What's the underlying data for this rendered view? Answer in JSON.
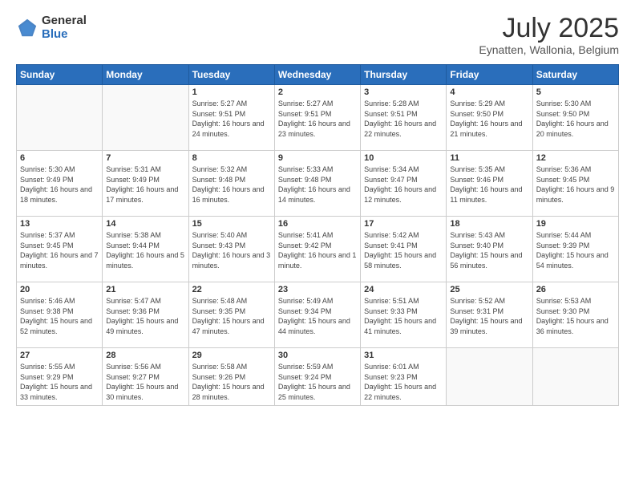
{
  "logo": {
    "general": "General",
    "blue": "Blue"
  },
  "header": {
    "month": "July 2025",
    "location": "Eynatten, Wallonia, Belgium"
  },
  "days_header": [
    "Sunday",
    "Monday",
    "Tuesday",
    "Wednesday",
    "Thursday",
    "Friday",
    "Saturday"
  ],
  "weeks": [
    [
      {
        "num": "",
        "info": ""
      },
      {
        "num": "",
        "info": ""
      },
      {
        "num": "1",
        "info": "Sunrise: 5:27 AM\nSunset: 9:51 PM\nDaylight: 16 hours and 24 minutes."
      },
      {
        "num": "2",
        "info": "Sunrise: 5:27 AM\nSunset: 9:51 PM\nDaylight: 16 hours and 23 minutes."
      },
      {
        "num": "3",
        "info": "Sunrise: 5:28 AM\nSunset: 9:51 PM\nDaylight: 16 hours and 22 minutes."
      },
      {
        "num": "4",
        "info": "Sunrise: 5:29 AM\nSunset: 9:50 PM\nDaylight: 16 hours and 21 minutes."
      },
      {
        "num": "5",
        "info": "Sunrise: 5:30 AM\nSunset: 9:50 PM\nDaylight: 16 hours and 20 minutes."
      }
    ],
    [
      {
        "num": "6",
        "info": "Sunrise: 5:30 AM\nSunset: 9:49 PM\nDaylight: 16 hours and 18 minutes."
      },
      {
        "num": "7",
        "info": "Sunrise: 5:31 AM\nSunset: 9:49 PM\nDaylight: 16 hours and 17 minutes."
      },
      {
        "num": "8",
        "info": "Sunrise: 5:32 AM\nSunset: 9:48 PM\nDaylight: 16 hours and 16 minutes."
      },
      {
        "num": "9",
        "info": "Sunrise: 5:33 AM\nSunset: 9:48 PM\nDaylight: 16 hours and 14 minutes."
      },
      {
        "num": "10",
        "info": "Sunrise: 5:34 AM\nSunset: 9:47 PM\nDaylight: 16 hours and 12 minutes."
      },
      {
        "num": "11",
        "info": "Sunrise: 5:35 AM\nSunset: 9:46 PM\nDaylight: 16 hours and 11 minutes."
      },
      {
        "num": "12",
        "info": "Sunrise: 5:36 AM\nSunset: 9:45 PM\nDaylight: 16 hours and 9 minutes."
      }
    ],
    [
      {
        "num": "13",
        "info": "Sunrise: 5:37 AM\nSunset: 9:45 PM\nDaylight: 16 hours and 7 minutes."
      },
      {
        "num": "14",
        "info": "Sunrise: 5:38 AM\nSunset: 9:44 PM\nDaylight: 16 hours and 5 minutes."
      },
      {
        "num": "15",
        "info": "Sunrise: 5:40 AM\nSunset: 9:43 PM\nDaylight: 16 hours and 3 minutes."
      },
      {
        "num": "16",
        "info": "Sunrise: 5:41 AM\nSunset: 9:42 PM\nDaylight: 16 hours and 1 minute."
      },
      {
        "num": "17",
        "info": "Sunrise: 5:42 AM\nSunset: 9:41 PM\nDaylight: 15 hours and 58 minutes."
      },
      {
        "num": "18",
        "info": "Sunrise: 5:43 AM\nSunset: 9:40 PM\nDaylight: 15 hours and 56 minutes."
      },
      {
        "num": "19",
        "info": "Sunrise: 5:44 AM\nSunset: 9:39 PM\nDaylight: 15 hours and 54 minutes."
      }
    ],
    [
      {
        "num": "20",
        "info": "Sunrise: 5:46 AM\nSunset: 9:38 PM\nDaylight: 15 hours and 52 minutes."
      },
      {
        "num": "21",
        "info": "Sunrise: 5:47 AM\nSunset: 9:36 PM\nDaylight: 15 hours and 49 minutes."
      },
      {
        "num": "22",
        "info": "Sunrise: 5:48 AM\nSunset: 9:35 PM\nDaylight: 15 hours and 47 minutes."
      },
      {
        "num": "23",
        "info": "Sunrise: 5:49 AM\nSunset: 9:34 PM\nDaylight: 15 hours and 44 minutes."
      },
      {
        "num": "24",
        "info": "Sunrise: 5:51 AM\nSunset: 9:33 PM\nDaylight: 15 hours and 41 minutes."
      },
      {
        "num": "25",
        "info": "Sunrise: 5:52 AM\nSunset: 9:31 PM\nDaylight: 15 hours and 39 minutes."
      },
      {
        "num": "26",
        "info": "Sunrise: 5:53 AM\nSunset: 9:30 PM\nDaylight: 15 hours and 36 minutes."
      }
    ],
    [
      {
        "num": "27",
        "info": "Sunrise: 5:55 AM\nSunset: 9:29 PM\nDaylight: 15 hours and 33 minutes."
      },
      {
        "num": "28",
        "info": "Sunrise: 5:56 AM\nSunset: 9:27 PM\nDaylight: 15 hours and 30 minutes."
      },
      {
        "num": "29",
        "info": "Sunrise: 5:58 AM\nSunset: 9:26 PM\nDaylight: 15 hours and 28 minutes."
      },
      {
        "num": "30",
        "info": "Sunrise: 5:59 AM\nSunset: 9:24 PM\nDaylight: 15 hours and 25 minutes."
      },
      {
        "num": "31",
        "info": "Sunrise: 6:01 AM\nSunset: 9:23 PM\nDaylight: 15 hours and 22 minutes."
      },
      {
        "num": "",
        "info": ""
      },
      {
        "num": "",
        "info": ""
      }
    ]
  ]
}
